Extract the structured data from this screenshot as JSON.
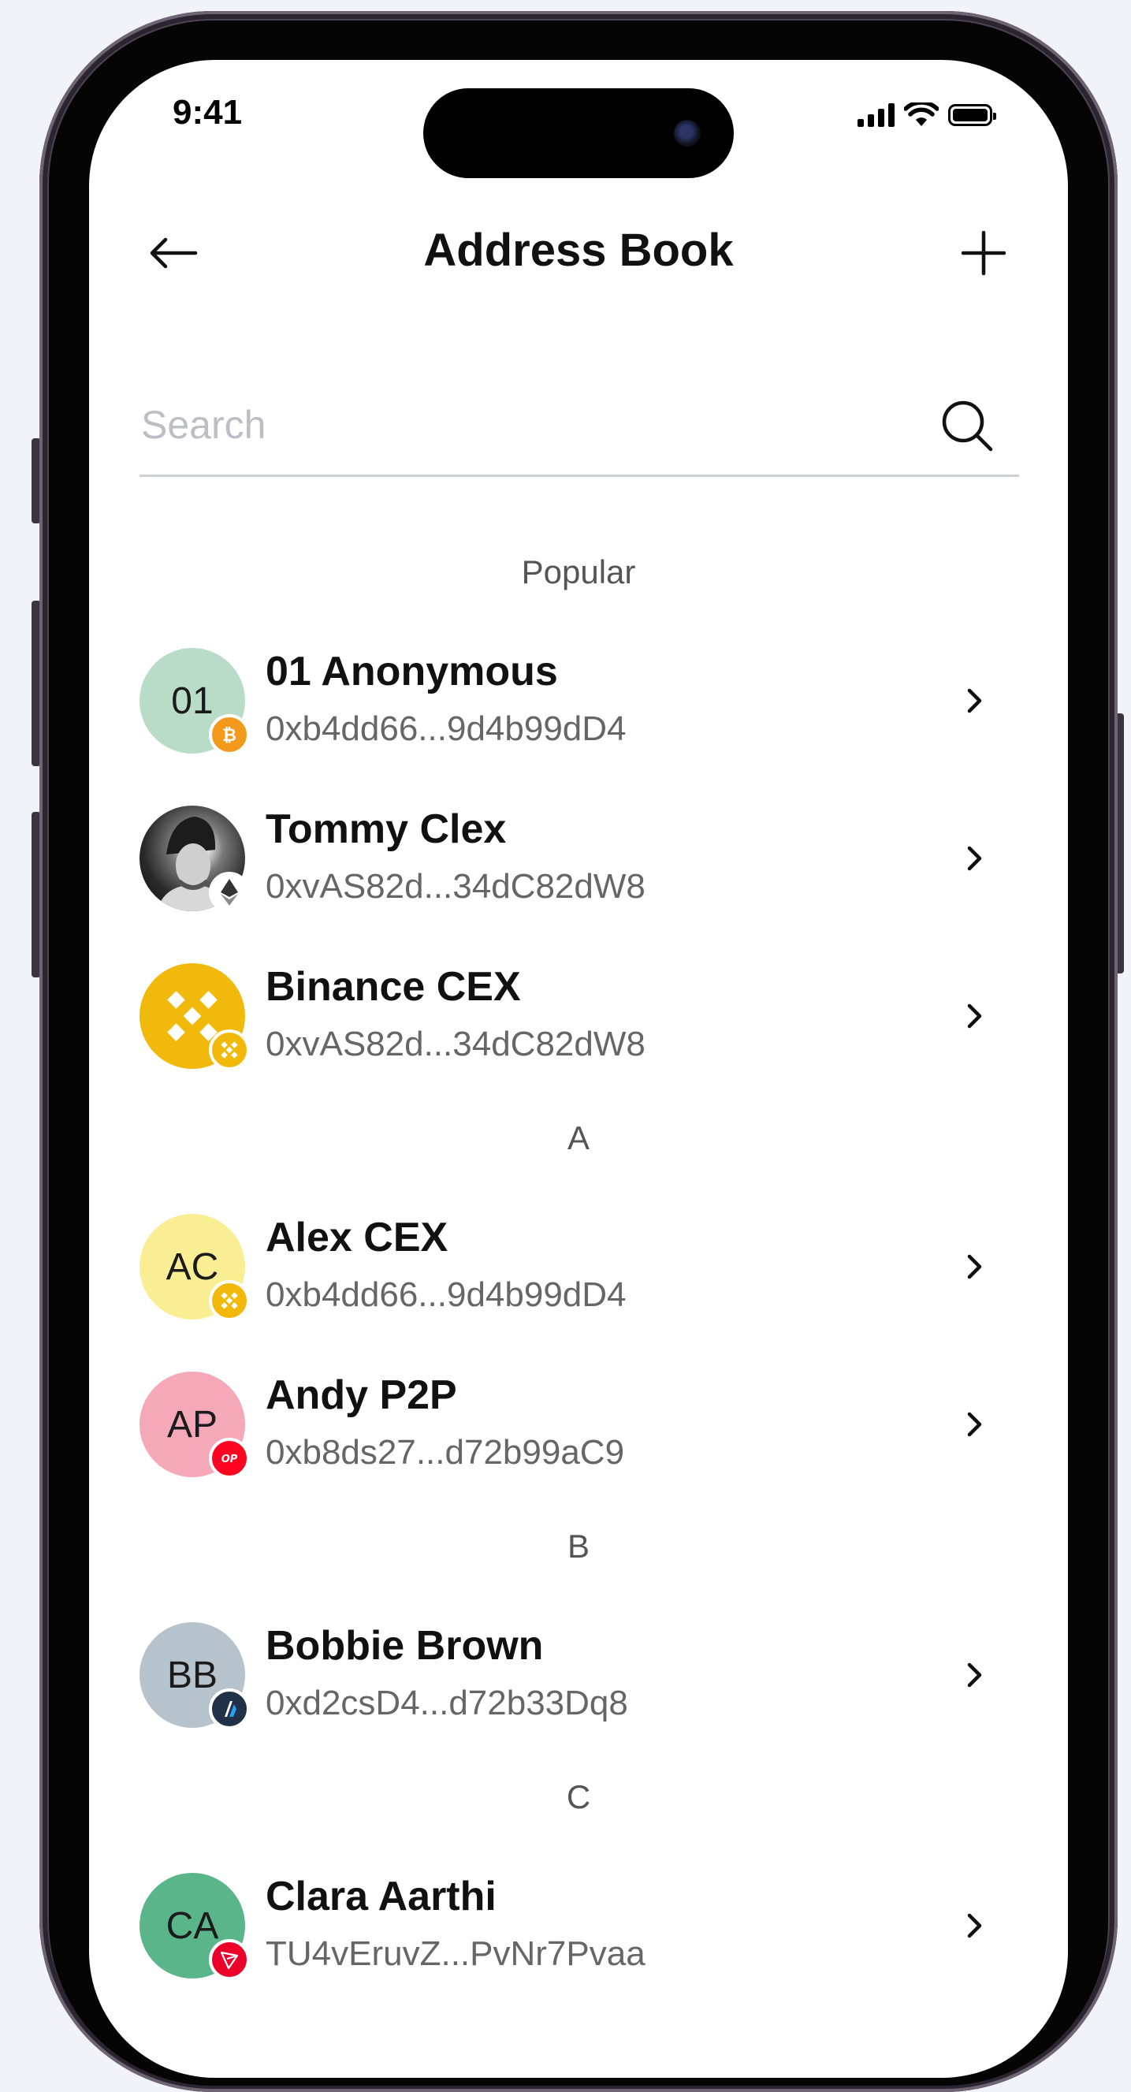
{
  "status_bar": {
    "time": "9:41"
  },
  "header": {
    "title": "Address Book"
  },
  "search": {
    "placeholder": "Search"
  },
  "sections": [
    {
      "header": "Popular",
      "contacts": [
        {
          "initials": "01",
          "name": "01 Anonymous",
          "address": "0xb4dd66...9d4b99dD4",
          "avatar_color": "#b9dcc8",
          "badge": "bitcoin-icon",
          "badge_color": "#f39a1d"
        },
        {
          "initials": "",
          "name": "Tommy Clex",
          "address": "0xvAS82d...34dC82dW8",
          "avatar_color": "#2a2a2a",
          "badge": "ethereum-icon",
          "badge_color": "#ffffff"
        },
        {
          "initials": "",
          "name": "Binance CEX",
          "address": "0xvAS82d...34dC82dW8",
          "avatar_color": "#f0b90b",
          "badge": "bnb-icon",
          "badge_color": "#f0b90b"
        }
      ]
    },
    {
      "header": "A",
      "contacts": [
        {
          "initials": "AC",
          "name": "Alex CEX",
          "address": "0xb4dd66...9d4b99dD4",
          "avatar_color": "#f9ee94",
          "badge": "bnb-icon",
          "badge_color": "#f0b90b"
        },
        {
          "initials": "AP",
          "name": "Andy P2P",
          "address": "0xb8ds27...d72b99aC9",
          "avatar_color": "#f5a9b8",
          "badge": "optimism-icon",
          "badge_color": "#ff0420"
        }
      ]
    },
    {
      "header": "B",
      "contacts": [
        {
          "initials": "BB",
          "name": "Bobbie Brown",
          "address": "0xd2csD4...d72b33Dq8",
          "avatar_color": "#b6c2cc",
          "badge": "arbitrum-icon",
          "badge_color": "#213147"
        }
      ]
    },
    {
      "header": "C",
      "contacts": [
        {
          "initials": "CA",
          "name": "Clara Aarthi",
          "address": "TU4vEruvZ...PvNr7Pvaa",
          "avatar_color": "#5bb58a",
          "badge": "tron-icon",
          "badge_color": "#eb0029"
        }
      ]
    }
  ]
}
